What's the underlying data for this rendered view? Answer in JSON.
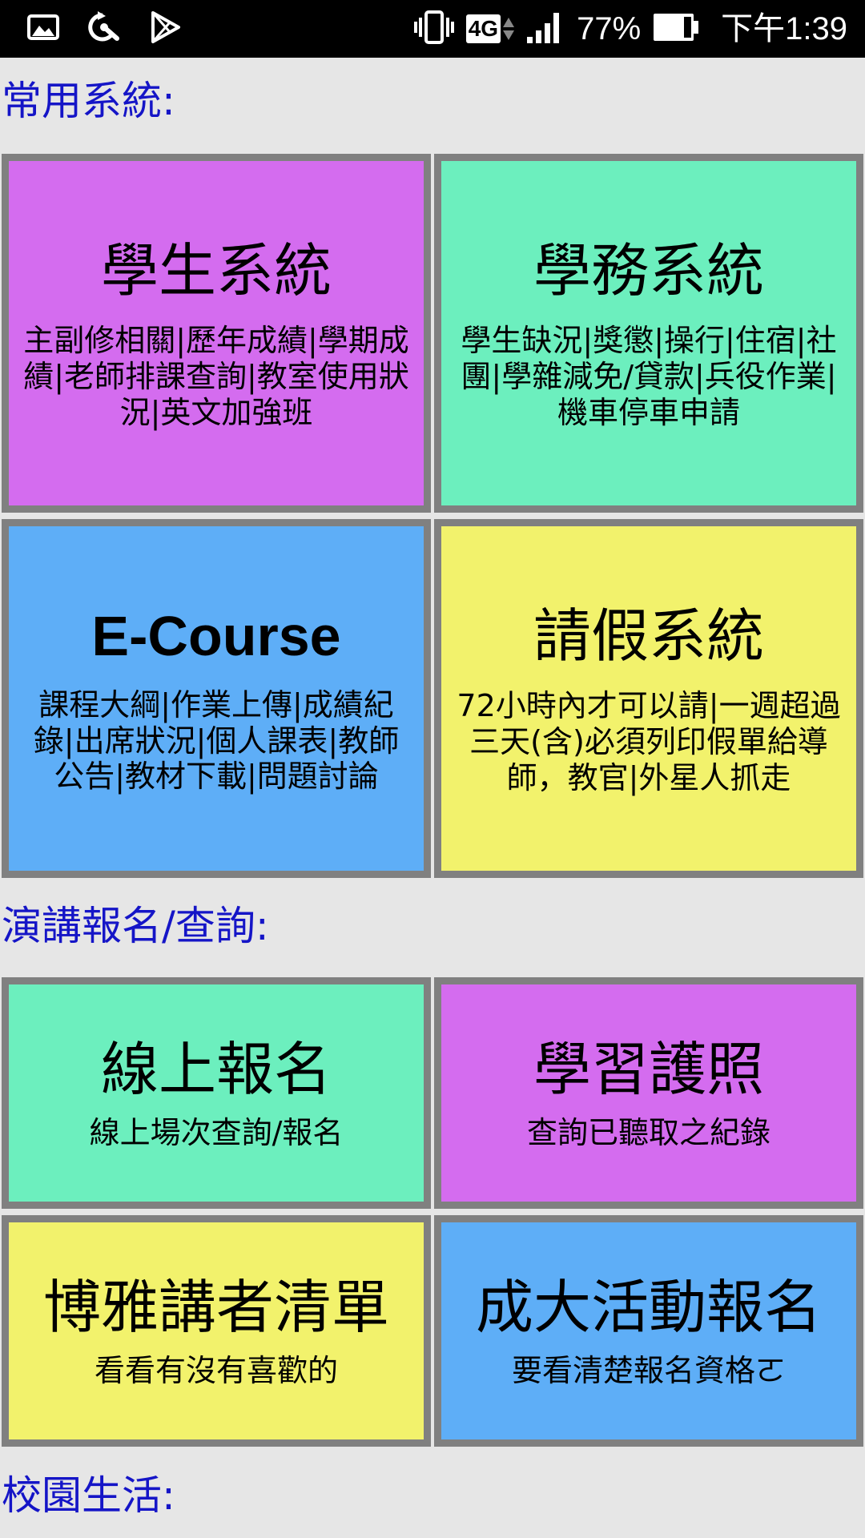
{
  "status_bar": {
    "network_type": "4G",
    "battery_percent": "77%",
    "time": "下午1:39",
    "icons": [
      "gallery-icon",
      "sync-wrench-icon",
      "play-store-icon",
      "vibrate-icon",
      "lte-icon",
      "signal-icon",
      "battery-icon"
    ]
  },
  "sections": [
    {
      "heading": "常用系統:",
      "tiles": [
        {
          "title": "學生系統",
          "desc": "主副修相關|歷年成績|學期成績|老師排課查詢|教室使用狀況|英文加強班",
          "color": "#d46cef"
        },
        {
          "title": "學務系統",
          "desc": "學生缺況|獎懲|操行|住宿|社團|學雜減免/貸款|兵役作業|機車停車申請",
          "color": "#6cefbe"
        },
        {
          "title": "E-Course",
          "desc": "課程大綱|作業上傳|成績紀錄|出席狀況|個人課表|教師公告|教材下載|問題討論",
          "color": "#5eaef7"
        },
        {
          "title": "請假系統",
          "desc": "72小時內才可以請|一週超過三天(含)必須列印假單給導師，教官|外星人抓走",
          "color": "#f2f26c"
        }
      ]
    },
    {
      "heading": "演講報名/查詢:",
      "tiles": [
        {
          "title": "線上報名",
          "desc": "線上場次查詢/報名",
          "color": "#6cefbe"
        },
        {
          "title": "學習護照",
          "desc": "查詢已聽取之紀錄",
          "color": "#d46cef"
        },
        {
          "title": "博雅講者清單",
          "desc": "看看有沒有喜歡的",
          "color": "#f2f26c"
        },
        {
          "title": "成大活動報名",
          "desc": "要看清楚報名資格ㄛ",
          "color": "#5eaef7"
        }
      ]
    },
    {
      "heading": "校園生活:"
    }
  ]
}
